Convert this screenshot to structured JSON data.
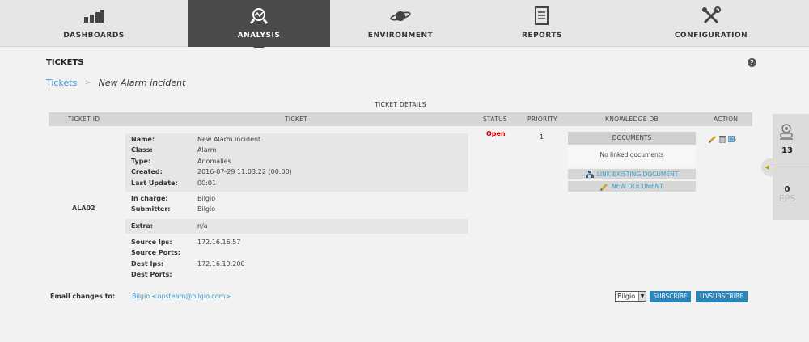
{
  "nav": {
    "items": [
      {
        "label": "DASHBOARDS",
        "icon": "bar-chart-icon"
      },
      {
        "label": "ANALYSIS",
        "icon": "magnifier-analysis-icon",
        "active": true
      },
      {
        "label": "ENVIRONMENT",
        "icon": "planet-icon"
      },
      {
        "label": "REPORTS",
        "icon": "document-icon"
      },
      {
        "label": "CONFIGURATION",
        "icon": "tools-icon"
      }
    ]
  },
  "page": {
    "title": "TICKETS",
    "help": "?",
    "breadcrumb": {
      "link": "Tickets",
      "separator": ">",
      "current": "New Alarm incident"
    }
  },
  "table": {
    "section_title": "TICKET DETAILS",
    "headers": [
      "TICKET ID",
      "TICKET",
      "STATUS",
      "PRIORITY",
      "KNOWLEDGE DB",
      "ACTION"
    ]
  },
  "ticket": {
    "id": "ALA02",
    "status": "Open",
    "priority": "1",
    "groups": [
      [
        {
          "label": "Name:",
          "value": "New Alarm incident"
        },
        {
          "label": "Class:",
          "value": "Alarm"
        },
        {
          "label": "Type:",
          "value": "Anomalies"
        },
        {
          "label": "Created:",
          "value": "2016-07-29 11:03:22 (00:00)"
        },
        {
          "label": "Last Update:",
          "value": "00:01"
        }
      ],
      [
        {
          "label": "In charge:",
          "value": "Bilgio"
        },
        {
          "label": "Submitter:",
          "value": "Bilgio"
        }
      ],
      [
        {
          "label": "Extra:",
          "value": "n/a"
        }
      ],
      [
        {
          "label": "Source Ips:",
          "value": "172.16.16.57"
        },
        {
          "label": "Source Ports:",
          "value": ""
        },
        {
          "label": "Dest Ips:",
          "value": "172.16.19.200"
        },
        {
          "label": "Dest Ports:",
          "value": ""
        }
      ]
    ]
  },
  "knowledge_db": {
    "header": "DOCUMENTS",
    "empty_text": "No linked documents",
    "link_button": "LINK EXISTING DOCUMENT",
    "new_button": "NEW DOCUMENT"
  },
  "actions": [
    "edit-pencil-icon",
    "delete-trash-icon",
    "export-icon"
  ],
  "email": {
    "label": "Email changes to:",
    "value": "Bilgio <opsteam@bilgio.com>",
    "select_value": "Bilgio",
    "subscribe": "SUBSCRIBE",
    "unsubscribe": "UNSUBSCRIBE"
  },
  "side_widget": {
    "alarm_count": "13",
    "eps_count": "0",
    "eps_label": "EPS"
  },
  "colors": {
    "nav_active": "#4a4a4a",
    "link": "#3a9bc9",
    "status_open": "#d40000",
    "button": "#2a85b8"
  }
}
